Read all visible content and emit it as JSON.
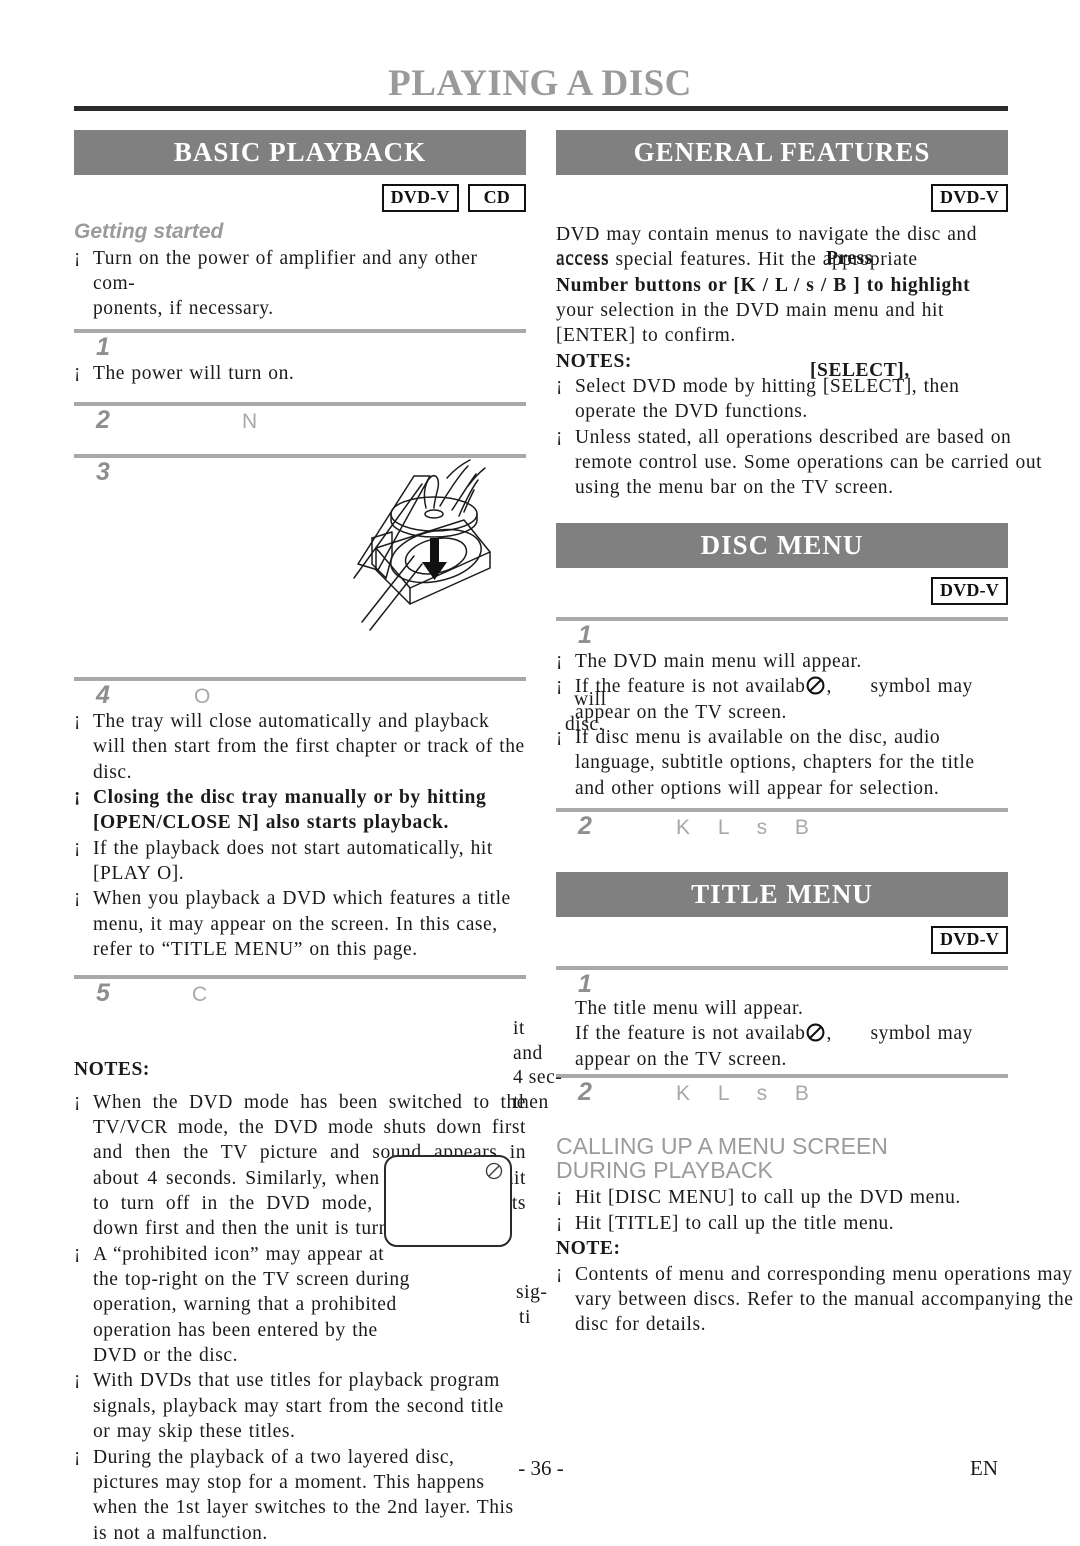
{
  "page": {
    "title": "PLAYING A DISC",
    "footer_page_number": "- 36 -",
    "footer_language": "EN"
  },
  "colors": {
    "banner_bg": "#808080",
    "banner_text": "#ffffff",
    "subhead_gray": "#9b9b9b",
    "rule_gray": "#a9a9a9",
    "title_gray": "#9a9a9a",
    "title_rule": "#2b2b2b",
    "body_text": "#1a1a1a"
  },
  "left_column": {
    "banner": "BASIC PLAYBACK",
    "badges": [
      "DVD-V",
      "CD"
    ],
    "subhead": "Getting started",
    "intro_bullets": [
      "Turn on the power of amplifier and any other com-",
      "ponents, if necessary."
    ],
    "steps": [
      {
        "number": "1",
        "glyphs": "",
        "bullets": [
          "The power will turn on."
        ]
      },
      {
        "number": "2",
        "glyphs": "N",
        "bullets": []
      },
      {
        "number": "3",
        "glyphs": "",
        "bullets": []
      },
      {
        "number": "4",
        "glyphs": "O",
        "bullets": [
          "The tray will close automatically and playback will then start from the first chapter or track of the disc.",
          "Closing the disc tray manually or by hitting [OPEN/CLOSE N] also starts playback.",
          "If the playback does not start automatically, hit [PLAY O].",
          "When you playback a DVD which features a title menu, it may appear on the screen. In this case, refer to “TITLE MENU” on this page."
        ]
      },
      {
        "number": "5",
        "glyphs": "C",
        "bullets": []
      }
    ],
    "notes_heading": "NOTES:",
    "notes": [
      "When the DVD mode has been switched to the TV/VCR mode, the DVD mode shuts down first and then the TV picture and sound appears in about 4 seconds. Similarly, when [POWER] is hit to turn off in the DVD mode, this mode shuts down first and then the unit is turned off.",
      "A “prohibited icon” may appear at the top-right on the TV screen during operation, warning that a prohibited operation has been entered by the DVD or the disc.",
      "With DVDs that use titles for playback program signals, playback may start from the second title or may skip these titles.",
      "During the playback of a two layered disc, pictures may stop for a moment. This happens when the 1st layer switches to the 2nd layer. This is not a malfunction."
    ]
  },
  "right_column": {
    "general_features": {
      "banner": "GENERAL FEATURES",
      "badges": [
        "DVD-V"
      ],
      "paragraph_lines": [
        "DVD may contain menus to navigate the disc and",
        "access special features. Hit the appropriate",
        "Number buttons or [K / L / s / B ] to highlight",
        "your selection in the DVD main menu and hit",
        "[ENTER] to confirm."
      ],
      "notes_heading": "NOTES:",
      "notes": [
        "Select DVD mode by hitting [SELECT], then operate the DVD functions.",
        "Unless stated, all operations described are based on remote control use. Some operations can be carried out using the menu bar on the TV screen."
      ]
    },
    "disc_menu": {
      "banner": "DISC MENU",
      "badges": [
        "DVD-V"
      ],
      "steps": [
        {
          "number": "1",
          "glyphs": "",
          "bullets": [
            "The DVD main menu will appear.",
            "If the feature is not available, symbol may appear on the TV screen.",
            "If disc menu is available on the disc, audio language, subtitle options, chapters for the title and other options will appear for selection."
          ]
        },
        {
          "number": "2",
          "glyphs": "K L s B",
          "bullets": []
        }
      ]
    },
    "title_menu": {
      "banner": "TITLE MENU",
      "badges": [
        "DVD-V"
      ],
      "steps": [
        {
          "number": "1",
          "glyphs": "",
          "bullets": [
            "The title menu will appear.",
            "If the feature is not available, symbol may appear on the TV screen."
          ]
        },
        {
          "number": "2",
          "glyphs": "K L s B",
          "bullets": []
        }
      ]
    },
    "calling_up": {
      "heading_line1": "CALLING UP A MENU SCREEN",
      "heading_line2": "DURING PLAYBACK",
      "bullets": [
        "Hit [DISC MENU] to call up the DVD menu.",
        "Hit [TITLE] to call up the title menu."
      ],
      "note_heading": "NOTE:",
      "note": "Contents of menu and corresponding menu operations may vary between discs. Refer to the manual accompanying the disc for details."
    }
  },
  "scan_artifacts": {
    "gf_overlap_access": "access",
    "gf_overlap_press": "Press",
    "gf_overlap_select": "[SELECT],",
    "left_overlap_will": "will",
    "left_overlap_disc": "disc.",
    "left_overlap_it": "it",
    "left_overlap_and": "and",
    "left_overlap_sec": "4 sec-",
    "left_overlap_then": "then",
    "left_overlap_is": "is",
    "left_overlap_or": "or",
    "tm_overlap_the": "the",
    "tm_overlap_and": "and",
    "cu_overlap_sig": "sig-",
    "cu_overlap_ti": "ti"
  }
}
